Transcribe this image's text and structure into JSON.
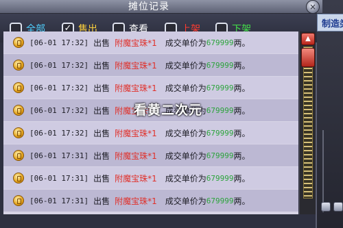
{
  "window": {
    "title": "摊位记录",
    "close_label": "×"
  },
  "side_panel": {
    "tab_label": "制造类"
  },
  "filters": [
    {
      "label": "全部",
      "checked": false,
      "color": "#4fd0ff"
    },
    {
      "label": "售出",
      "checked": true,
      "color": "#ffd23c"
    },
    {
      "label": "查看",
      "checked": false,
      "color": "#ffffff"
    },
    {
      "label": "上架",
      "checked": false,
      "color": "#ff3b30"
    },
    {
      "label": "下架",
      "checked": false,
      "color": "#43e04a"
    }
  ],
  "records": [
    {
      "timestamp": "[06-01 17:32]",
      "action": "出售",
      "item": "附魔宝珠*1",
      "price_label": "成交单价为",
      "price": "679999",
      "unit": "两。"
    },
    {
      "timestamp": "[06-01 17:32]",
      "action": "出售",
      "item": "附魔宝珠*1",
      "price_label": "成交单价为",
      "price": "679999",
      "unit": "两。"
    },
    {
      "timestamp": "[06-01 17:32]",
      "action": "出售",
      "item": "附魔宝珠*1",
      "price_label": "成交单价为",
      "price": "679999",
      "unit": "两。"
    },
    {
      "timestamp": "[06-01 17:32]",
      "action": "出售",
      "item": "附魔宝珠*1",
      "price_label": "成交单价为",
      "price": "679999",
      "unit": "两。"
    },
    {
      "timestamp": "[06-01 17:32]",
      "action": "出售",
      "item": "附魔宝珠*1",
      "price_label": "成交单价为",
      "price": "679999",
      "unit": "两。"
    },
    {
      "timestamp": "[06-01 17:31]",
      "action": "出售",
      "item": "附魔宝珠*1",
      "price_label": "成交单价为",
      "price": "679999",
      "unit": "两。"
    },
    {
      "timestamp": "[06-01 17:31]",
      "action": "出售",
      "item": "附魔宝珠*1",
      "price_label": "成交单价为",
      "price": "679999",
      "unit": "两。"
    },
    {
      "timestamp": "[06-01 17:31]",
      "action": "出售",
      "item": "附魔宝珠*1",
      "price_label": "成交单价为",
      "price": "679999",
      "unit": "两。"
    }
  ],
  "scrollbar": {
    "up_arrow": "▲",
    "position": 0.0
  },
  "watermark": "看黄二次元",
  "icons": {
    "record_icon": "gold-coin-icon",
    "check_mark": "✓"
  }
}
